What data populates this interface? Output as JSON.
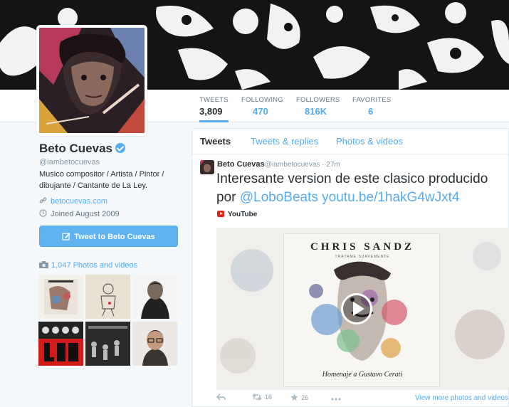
{
  "colors": {
    "accent": "#55acee",
    "text": "#292f33",
    "muted": "#8899a6",
    "background": "#f5f8fa"
  },
  "nav": {
    "stats": [
      {
        "label": "TWEETS",
        "value": "3,809"
      },
      {
        "label": "FOLLOWING",
        "value": "470"
      },
      {
        "label": "FOLLOWERS",
        "value": "816K"
      },
      {
        "label": "FAVORITES",
        "value": "6"
      }
    ]
  },
  "profile": {
    "name": "Beto Cuevas",
    "screen_name": "@iambetocuevas",
    "bio": "Musico compositor / Artista / Pintor / dibujante / Cantante de La Ley.",
    "website": "betocuevas.com",
    "joined": "Joined August 2009",
    "tweet_to_label": "Tweet to Beto Cuevas",
    "photos_label": "1,047 Photos and videos",
    "icons": [
      "verified-icon",
      "link-icon",
      "calendar-icon",
      "compose-icon",
      "camera-icon"
    ]
  },
  "timeline": {
    "tabs": [
      "Tweets",
      "Tweets & replies",
      "Photos & videos"
    ],
    "tweet": {
      "author": "Beto Cuevas",
      "handle_time": "@iambetocuevas · 27m",
      "text": "Interesante version de este clasico producido por ",
      "mention": "@LoboBeats",
      "link": "youtu.be/1hakG4wJxt4",
      "card_source": "YouTube",
      "media": {
        "album_title": "CHRIS SANDZ",
        "album_subtitle": "TRÁTAME SUAVEMENTE",
        "album_footer": "Homenaje a Gustavo Cerati"
      },
      "actions": {
        "retweets": "16",
        "favorites": "26"
      },
      "view_more": "View more photos and videos"
    }
  }
}
